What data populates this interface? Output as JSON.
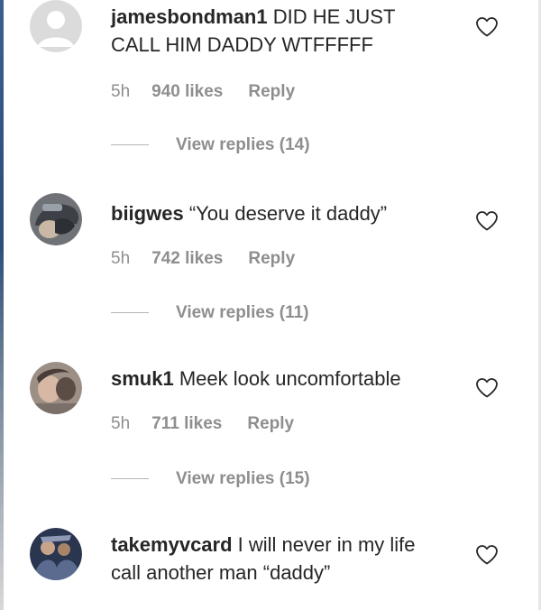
{
  "comments": [
    {
      "avatar": "default-avatar",
      "username": "jamesbondman1",
      "text": "DID HE JUST CALL HIM DADDY WTFFFFF",
      "time": "5h",
      "likes": "940 likes",
      "reply": "Reply",
      "view_replies": "View replies (14)",
      "like_icon": "heart-outline-icon"
    },
    {
      "avatar": "user-photo-avatar",
      "username": "biigwes",
      "text": "“You deserve it daddy”",
      "time": "5h",
      "likes": "742 likes",
      "reply": "Reply",
      "view_replies": "View replies (11)",
      "like_icon": "heart-outline-icon"
    },
    {
      "avatar": "user-photo-avatar",
      "username": "smuk1",
      "text": "Meek look uncomfortable",
      "time": "5h",
      "likes": "711 likes",
      "reply": "Reply",
      "view_replies": "View replies (15)",
      "like_icon": "heart-outline-icon"
    },
    {
      "avatar": "user-photo-avatar",
      "username": "takemyvcard",
      "text": "I will never in my life call another man “daddy”",
      "like_icon": "heart-outline-icon"
    }
  ],
  "colors": {
    "text": "#262626",
    "secondary": "#8e8e8e",
    "divider": "#b5b5b5"
  }
}
